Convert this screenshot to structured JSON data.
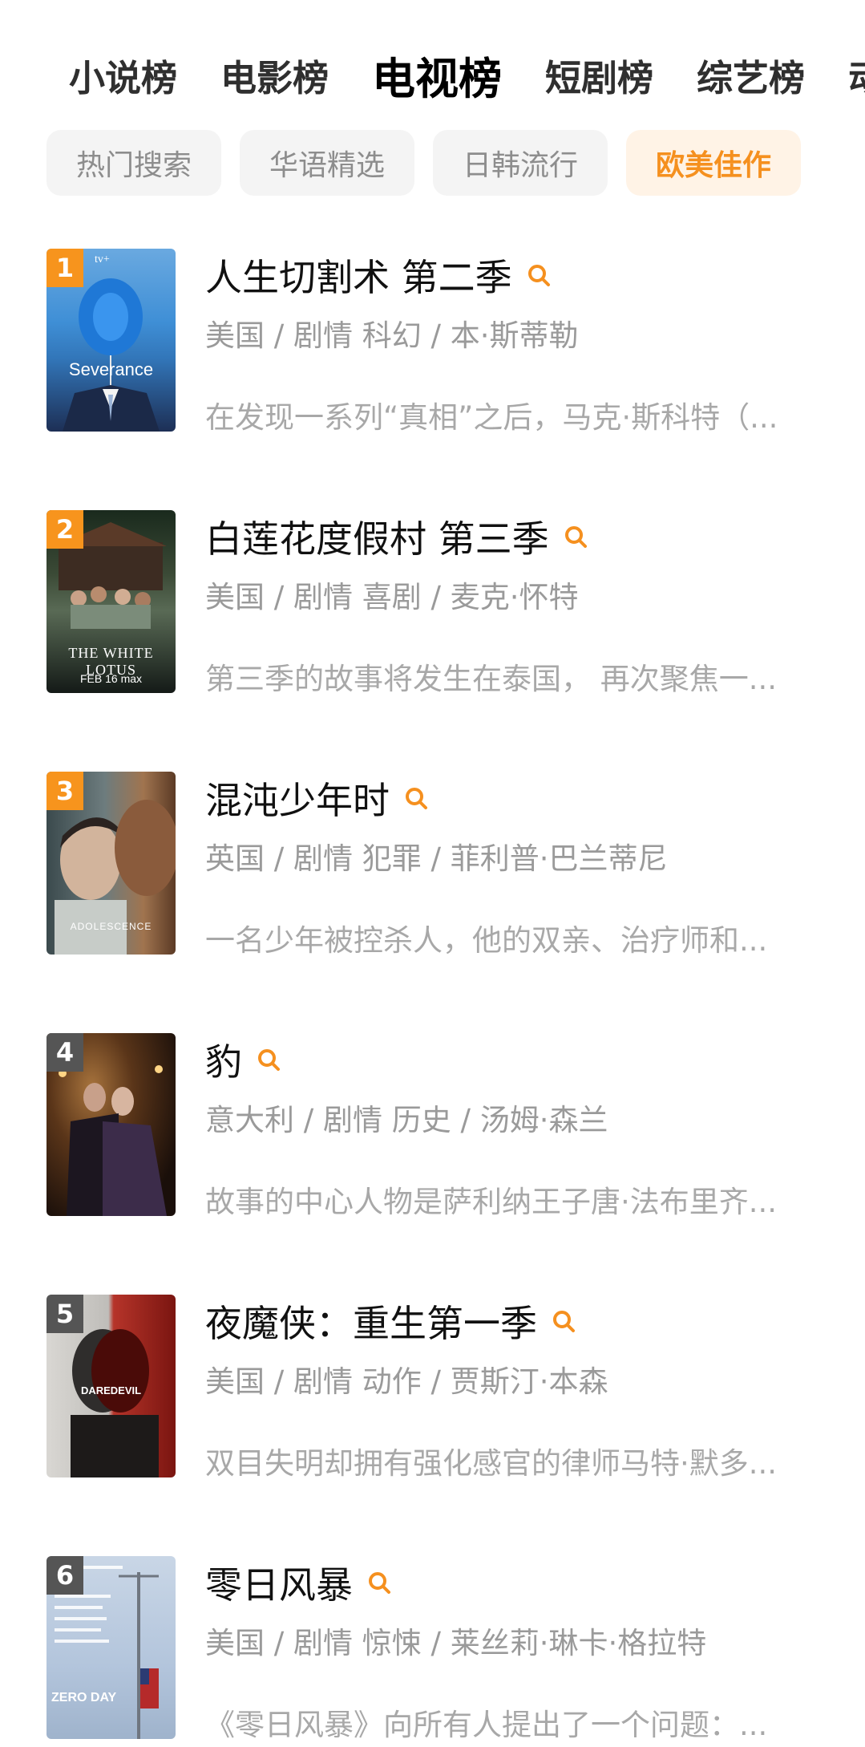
{
  "tabs": [
    "小说榜",
    "电影榜",
    "电视榜",
    "短剧榜",
    "综艺榜",
    "动"
  ],
  "active_tab_index": 2,
  "filters": [
    "热门搜索",
    "华语精选",
    "日韩流行",
    "欧美佳作"
  ],
  "active_filter_index": 3,
  "accent_color": "#f5901f",
  "items": [
    {
      "rank": "1",
      "rank_color": "#f7941d",
      "title": "人生切割术 第二季",
      "meta": "美国 / 剧情 科幻 / 本·斯蒂勒",
      "desc": "在发现一系列“真相”之后，马克·斯科特（...",
      "poster_text": "Severance",
      "poster_top": "tv+"
    },
    {
      "rank": "2",
      "rank_color": "#f7941d",
      "title": "白莲花度假村 第三季",
      "meta": "美国 / 剧情 喜剧 / 麦克·怀特",
      "desc": "第三季的故事将发生在泰国， 再次聚焦一...",
      "poster_text": "THE WHITE LOTUS",
      "poster_sub": "FEB 16  max"
    },
    {
      "rank": "3",
      "rank_color": "#f7941d",
      "title": "混沌少年时",
      "meta": "英国 / 剧情 犯罪 / 菲利普·巴兰蒂尼",
      "desc": "一名少年被控杀人，他的双亲、治疗师和...",
      "poster_text": "ADOLESCENCE"
    },
    {
      "rank": "4",
      "rank_color": "#555555",
      "title": "豹",
      "meta": "意大利 / 剧情 历史 / 汤姆·森兰",
      "desc": "故事的中心人物是萨利纳王子唐·法布里齐..."
    },
    {
      "rank": "5",
      "rank_color": "#555555",
      "title": "夜魔侠：重生第一季",
      "meta": "美国 / 剧情 动作 / 贾斯汀·本森",
      "desc": "双目失明却拥有强化感官的律师马特·默多...",
      "poster_text": "DAREDEVIL"
    },
    {
      "rank": "6",
      "rank_color": "#555555",
      "title": "零日风暴",
      "meta": "美国 / 剧情 惊悚 / 莱丝莉·琳卡·格拉特",
      "desc": "《零日风暴》向所有人提出了一个问题：...",
      "poster_text": "ZERO DAY"
    }
  ]
}
